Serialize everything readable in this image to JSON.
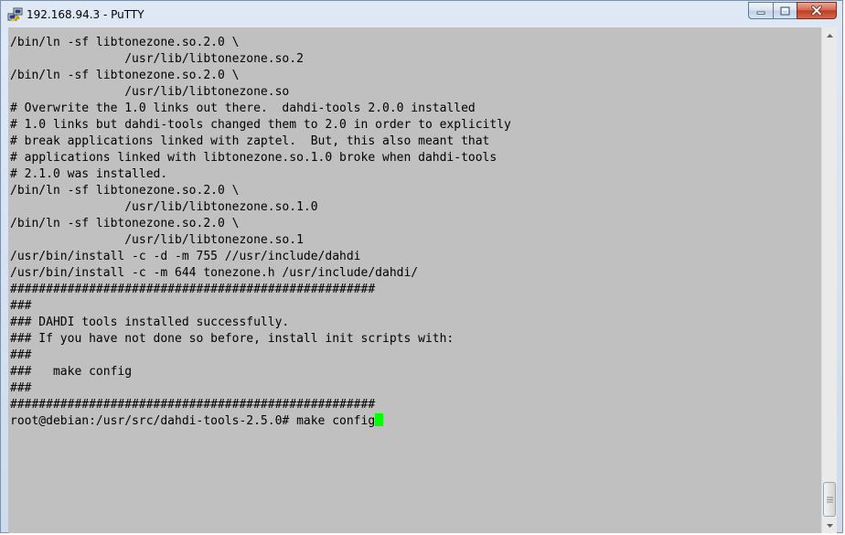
{
  "window": {
    "title": "192.168.94.3 - PuTTY"
  },
  "icons": {
    "app": "putty-icon",
    "minimize": "minimize-icon",
    "maximize": "maximize-icon",
    "close": "close-icon",
    "scroll_up": "chevron-up-icon",
    "scroll_down": "chevron-down-icon",
    "scroll_grip": "grip-icon"
  },
  "colors": {
    "terminal_background": "#c0c0c0",
    "terminal_text": "#000000",
    "cursor": "#00ff00",
    "close_button": "#c13e22"
  },
  "terminal": {
    "lines": [
      "/bin/ln -sf libtonezone.so.2.0 \\",
      "                /usr/lib/libtonezone.so.2",
      "/bin/ln -sf libtonezone.so.2.0 \\",
      "                /usr/lib/libtonezone.so",
      "# Overwrite the 1.0 links out there.  dahdi-tools 2.0.0 installed",
      "# 1.0 links but dahdi-tools changed them to 2.0 in order to explicitly",
      "# break applications linked with zaptel.  But, this also meant that",
      "# applications linked with libtonezone.so.1.0 broke when dahdi-tools",
      "# 2.1.0 was installed.",
      "/bin/ln -sf libtonezone.so.2.0 \\",
      "                /usr/lib/libtonezone.so.1.0",
      "/bin/ln -sf libtonezone.so.2.0 \\",
      "                /usr/lib/libtonezone.so.1",
      "/usr/bin/install -c -d -m 755 //usr/include/dahdi",
      "/usr/bin/install -c -m 644 tonezone.h /usr/include/dahdi/",
      "###################################################",
      "###",
      "### DAHDI tools installed successfully.",
      "### If you have not done so before, install init scripts with:",
      "###",
      "###   make config",
      "###",
      "###################################################"
    ],
    "prompt": "root@debian:/usr/src/dahdi-tools-2.5.0# make config"
  }
}
